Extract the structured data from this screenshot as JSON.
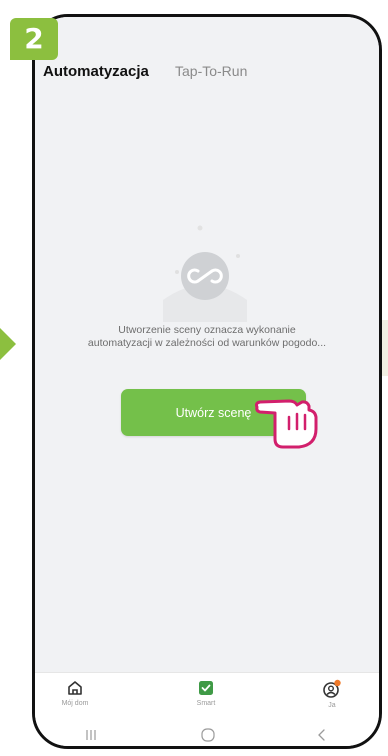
{
  "step": {
    "number": "2"
  },
  "tabs": [
    {
      "label": "Automatyzacja",
      "active": true
    },
    {
      "label": "Tap-To-Run",
      "active": false
    }
  ],
  "empty_state": {
    "icon": "scene-loop-icon",
    "line1": "Utworzenie sceny oznacza wykonanie",
    "line2": "automatyzacji w zależności od warunków pogodo..."
  },
  "create_button": {
    "label": "Utwórz scenę"
  },
  "bottom_nav": [
    {
      "label": "Mój dom",
      "icon": "home-icon",
      "active": false
    },
    {
      "label": "Smart",
      "icon": "smart-icon",
      "active": true
    },
    {
      "label": "Ja",
      "icon": "profile-icon",
      "active": false,
      "badge": true
    }
  ],
  "system_nav": [
    "recents-icon",
    "home-circle-icon",
    "back-chevron-icon"
  ],
  "colors": {
    "brand_green": "#8cbf3f",
    "button_green": "#74c04a",
    "pointer_magenta": "#d21f6c",
    "badge_orange": "#f07a2a"
  }
}
